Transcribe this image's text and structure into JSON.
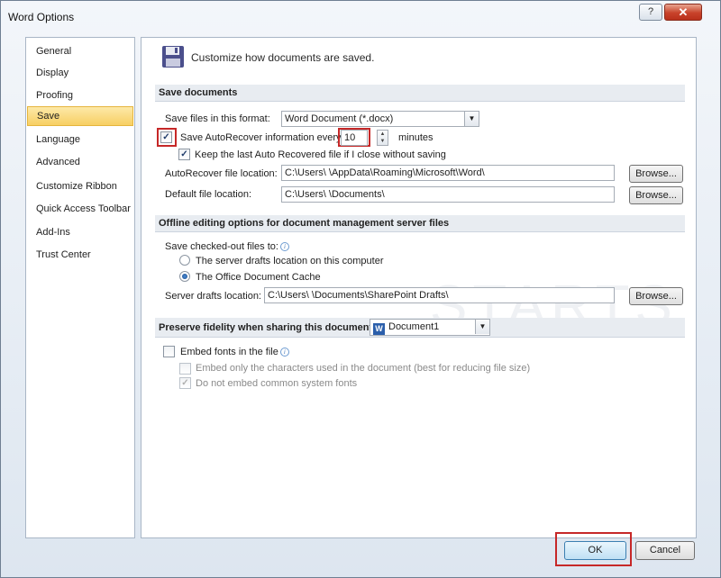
{
  "window": {
    "title": "Word Options",
    "help_glyph": "?",
    "close_glyph": "✕"
  },
  "sidebar": {
    "items": [
      {
        "label": "General"
      },
      {
        "label": "Display"
      },
      {
        "label": "Proofing"
      },
      {
        "label": "Save",
        "active": true
      },
      {
        "label": "Language"
      },
      {
        "label": "Advanced"
      },
      {
        "label": "Customize Ribbon"
      },
      {
        "label": "Quick Access Toolbar"
      },
      {
        "label": "Add-Ins"
      },
      {
        "label": "Trust Center"
      }
    ]
  },
  "header": {
    "text": "Customize how documents are saved.",
    "icon": "floppy-disk-icon"
  },
  "save_documents": {
    "section_title": "Save documents",
    "format_label": "Save files in this format:",
    "format_value": "Word Document (*.docx)",
    "autorecover_label": "Save AutoRecover information every",
    "autorecover_checked": true,
    "autorecover_minutes": "10",
    "minutes_label": "minutes",
    "keep_last_label": "Keep the last Auto Recovered file if I close without saving",
    "keep_last_checked": true,
    "autorecover_location_label": "AutoRecover file location:",
    "autorecover_location_value": "C:\\Users\\        \\AppData\\Roaming\\Microsoft\\Word\\",
    "default_location_label": "Default file location:",
    "default_location_value": "C:\\Users\\        \\Documents\\",
    "browse_label": "Browse..."
  },
  "offline": {
    "section_title": "Offline editing options for document management server files",
    "checkout_label": "Save checked-out files to:",
    "server_drafts_option": "The server drafts location on this computer",
    "office_cache_option": "The Office Document Cache",
    "selected_option": "office_cache",
    "server_drafts_location_label": "Server drafts location:",
    "server_drafts_location_value": "C:\\Users\\        \\Documents\\SharePoint Drafts\\",
    "browse_label": "Browse..."
  },
  "fidelity": {
    "section_title": "Preserve fidelity when sharing this document:",
    "document_value": "Document1",
    "embed_fonts_label": "Embed fonts in the file",
    "embed_fonts_checked": false,
    "embed_only_used_label": "Embed only the characters used in the document (best for reducing file size)",
    "do_not_embed_common_label": "Do not embed common system fonts",
    "do_not_embed_common_checked": true
  },
  "footer": {
    "ok_label": "OK",
    "cancel_label": "Cancel"
  },
  "watermark": "STARTS",
  "colors": {
    "accent_active": "#f7cf63",
    "highlight_frame": "#c62828",
    "section_bg": "#e8ecf1"
  }
}
